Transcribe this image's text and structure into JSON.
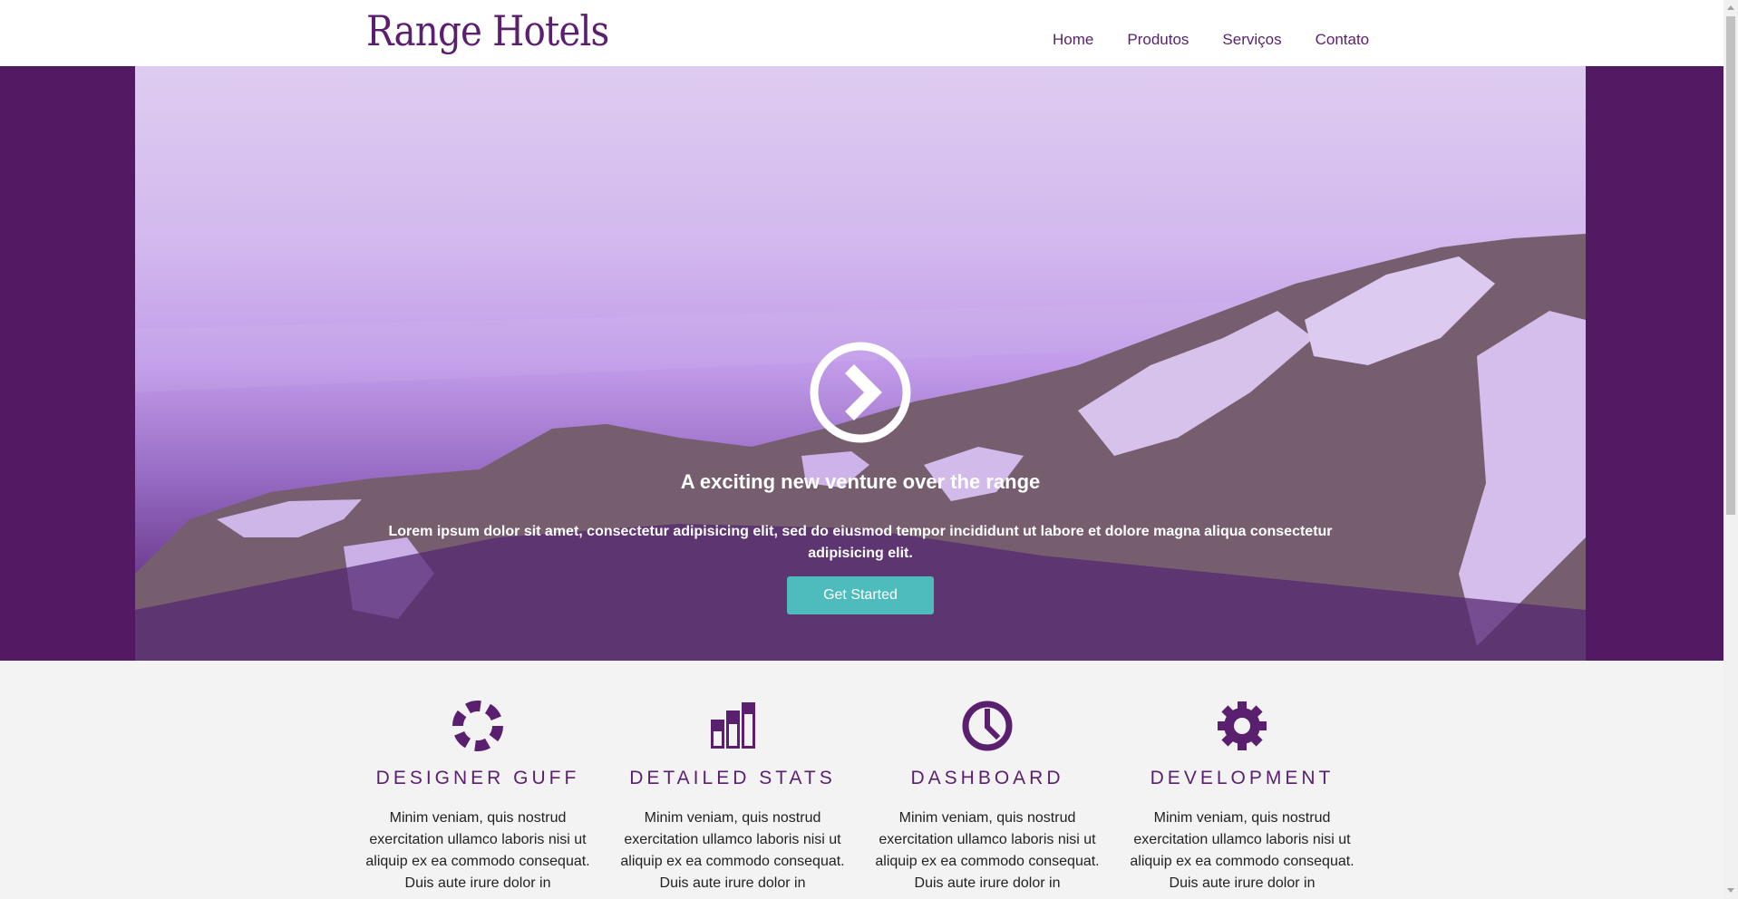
{
  "header": {
    "logo": "Range Hotels",
    "nav": [
      "Home",
      "Produtos",
      "Serviços",
      "Contato"
    ]
  },
  "hero": {
    "title": "A exciting new venture over the range",
    "text": "Lorem ipsum dolor sit amet, consectetur adipisicing elit, sed do eiusmod tempor incididunt ut labore et dolore magna aliqua consectetur adipisicing elit.",
    "button": "Get Started"
  },
  "features": [
    {
      "icon": "circle-notch-icon",
      "title": "DESIGNER GUFF",
      "text": "Minim veniam, quis nostrud exercitation ullamco laboris nisi ut aliquip ex ea commodo consequat. Duis aute irure dolor in"
    },
    {
      "icon": "bar-chart-icon",
      "title": "DETAILED STATS",
      "text": "Minim veniam, quis nostrud exercitation ullamco laboris nisi ut aliquip ex ea commodo consequat. Duis aute irure dolor in"
    },
    {
      "icon": "clock-icon",
      "title": "DASHBOARD",
      "text": "Minim veniam, quis nostrud exercitation ullamco laboris nisi ut aliquip ex ea commodo consequat. Duis aute irure dolor in"
    },
    {
      "icon": "gear-icon",
      "title": "DEVELOPMENT",
      "text": "Minim veniam, quis nostrud exercitation ullamco laboris nisi ut aliquip ex ea commodo consequat. Duis aute irure dolor in"
    }
  ],
  "colors": {
    "brand": "#5a1f6e",
    "hero_band": "#531a64",
    "button": "#4ebcbc"
  }
}
